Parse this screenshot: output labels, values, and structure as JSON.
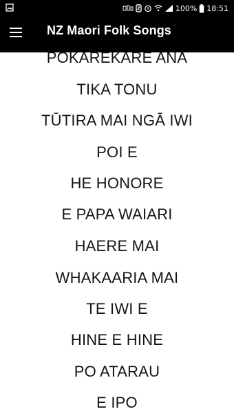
{
  "status_bar": {
    "battery_percent": "100%",
    "time": "18:51",
    "icons": {
      "left": "gallery-icon",
      "right": [
        "network-text-icon",
        "nfc-icon",
        "alarm-icon",
        "wifi-icon",
        "signal-icon",
        "battery-icon"
      ]
    }
  },
  "toolbar": {
    "title": "NZ Maori Folk Songs",
    "menu_icon": "hamburger-menu-icon",
    "background_color": "#000000",
    "text_color": "#ffffff"
  },
  "song_list": {
    "items": [
      "POKAREKARE ANA",
      "TIKA TONU",
      "TŪTIRA MAI NGĀ IWI",
      "POI E",
      "HE HONORE",
      "E PAPA WAIARI",
      "HAERE MAI",
      "WHAKAARIA MAI",
      "TE IWI E",
      "HINE E HINE",
      "PO ATARAU",
      "E IPO"
    ]
  }
}
